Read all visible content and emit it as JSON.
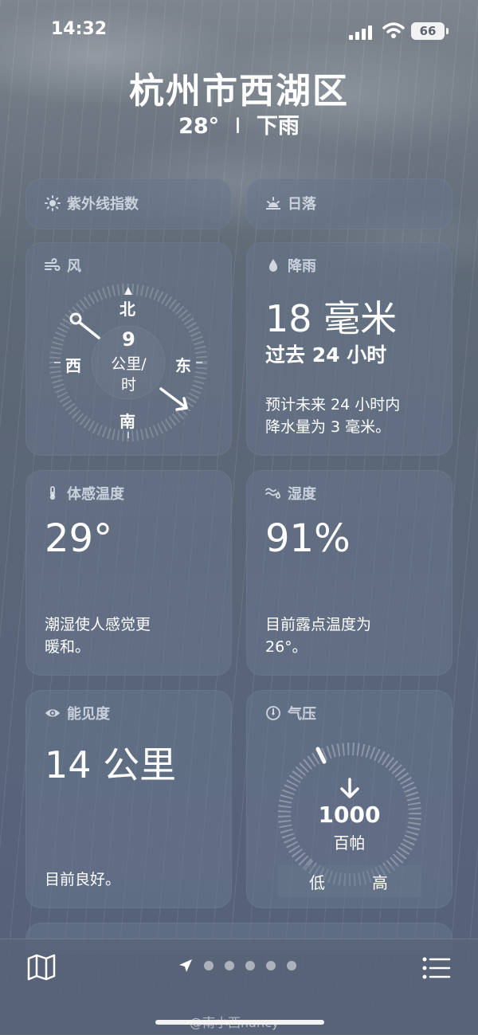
{
  "status_bar": {
    "time": "14:32",
    "battery": "66"
  },
  "location": {
    "city": "杭州市西湖区",
    "temperature": "28°",
    "separator": "I",
    "condition": "下雨"
  },
  "tiles": {
    "uv": {
      "title": "紫外线指数"
    },
    "sunset": {
      "title": "日落"
    },
    "wind": {
      "title": "风",
      "speed": "9",
      "unit_line1": "公里/",
      "unit_line2": "时",
      "n": "北",
      "s": "南",
      "e": "东",
      "w": "西"
    },
    "rain": {
      "title": "降雨",
      "amount": "18 毫米",
      "period": "过去 24 小时",
      "forecast_line1": "预计未来 24 小时内",
      "forecast_line2": "降水量为 3 毫米。"
    },
    "feels_like": {
      "title": "体感温度",
      "value": "29°",
      "desc_line1": "潮湿使人感觉更",
      "desc_line2": "暖和。"
    },
    "humidity": {
      "title": "湿度",
      "value": "91%",
      "desc_line1": "目前露点温度为",
      "desc_line2": "26°。"
    },
    "visibility": {
      "title": "能见度",
      "value": "14 公里",
      "desc": "目前良好。"
    },
    "pressure": {
      "title": "气压",
      "value": "1000",
      "unit": "百帕",
      "low": "低",
      "high": "高"
    }
  },
  "watermark": "@南小西nancy",
  "colors": {
    "card_bg": "#68768c",
    "text": "#ffffff"
  }
}
